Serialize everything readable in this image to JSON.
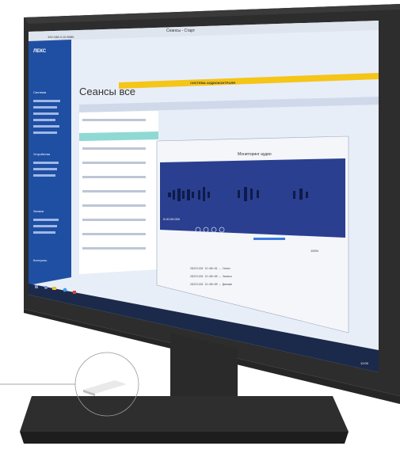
{
  "scene": {
    "description_hidden": "",
    "monitor_color": "#2b2b2b",
    "stand_color": "#2f2f2f"
  },
  "browser": {
    "tab_label": "Сеансы - Старт",
    "secondary_tab": "Система - Старт",
    "url": "192.168.0.10:8080"
  },
  "app": {
    "logo": "ЛЕКС",
    "page_title": "Сеансы все",
    "banner": "СИСТЕМА АУДИОКОНТРОЛЯ"
  },
  "sidebar": {
    "sections": [
      {
        "label": "Система"
      },
      {
        "label": "Устройства"
      },
      {
        "label": "Записи"
      },
      {
        "label": "Контроль"
      }
    ]
  },
  "player": {
    "title": "Мониторинг аудио",
    "time": "0:00:00:000",
    "zoom": "100%"
  },
  "log_lines": [
    "20231120 12:00:01 — Сеанс",
    "20231120 12:00:05 — Запись",
    "20231120 12:00:09 — Данные"
  ],
  "taskbar": {
    "time": "12:00"
  },
  "colors": {
    "accent": "#2f6fd1",
    "banner": "#f5c518",
    "waveform_bg": "#2a3f8f",
    "taskbar": "#1b2a4a"
  }
}
